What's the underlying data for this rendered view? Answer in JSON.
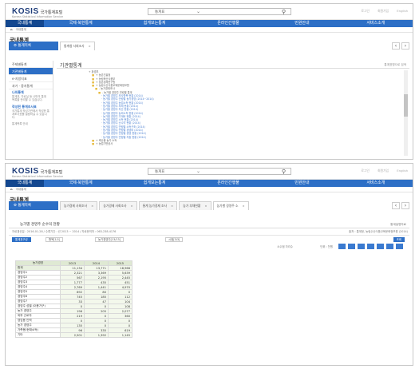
{
  "header": {
    "logo": "KOSIS",
    "logo_kr": "국가통계포털",
    "logo_sub": "Korean Statistical Information Service",
    "search_select": "통계표",
    "utils": [
      "로그인",
      "회원가입",
      "English"
    ]
  },
  "nav": [
    "국내통계",
    "국제·북한통계",
    "쉽게보는통계",
    "온라인간행물",
    "민원안내",
    "서비스소개"
  ],
  "breadcrumb": [
    "홈",
    "국내통계"
  ],
  "page_title": "국내통계",
  "tab_main_label": "통계목록",
  "shot1": {
    "tabs": [
      "통계청 사회조사"
    ],
    "sidebar_items": [
      "주제별통계",
      "기관별통계",
      "e-지방지표",
      "과거 · 중지통계"
    ],
    "side_blocks": [
      {
        "title": "나의통계",
        "text": "통계표, 자료실 등 나만의 통계 목록을 관리할 수 있습니다."
      },
      {
        "title": "작성된 통계조사표",
        "text": "국가통계 작성기관에서 작성한 통계조사표를 열람하실 수 있습니다."
      }
    ],
    "side_footer": "통계목록 안내",
    "panel_title": "기관별통계",
    "panel_right": "통계표명으로 검색",
    "tree": [
      {
        "indent": 18,
        "text": "+ 환경부"
      },
      {
        "indent": 22,
        "text": "+ 농촌진흥청",
        "folder": true
      },
      {
        "indent": 22,
        "text": "+ 농림축산식품부",
        "folder": true
      },
      {
        "indent": 22,
        "text": "+ 농촌경제연구원",
        "folder": true
      },
      {
        "indent": 22,
        "text": "+ 농림수산식품교육문화정보원",
        "folder": true
      },
      {
        "indent": 26,
        "text": "- 농가경제조사",
        "folder": true
      },
      {
        "indent": 30,
        "text": "- 농가별 경영주 연령별 통계",
        "folder": true
      },
      {
        "indent": 34,
        "text": "· 농가별 경영주 조사항목 현황 (2014)",
        "link": true
      },
      {
        "indent": 34,
        "text": "· 농가별 경영주 연령별 농가경영 (2014~2014)",
        "link": true
      },
      {
        "indent": 34,
        "text": "· 농가별 경영주 농업소득 현황 (2014)",
        "link": true
      },
      {
        "indent": 34,
        "text": "· 농가별 경영주 부채 현황 (2014)",
        "link": true
      },
      {
        "indent": 34,
        "text": "· 농가별 경영주 자산 현황 (2014)",
        "link": true
      },
      {
        "indent": 34,
        "text": "· 농가별 경영주 농외소득 현황 (2014)",
        "link": true
      },
      {
        "indent": 34,
        "text": "· 농가별 경영주 가계비 현황 (2014)",
        "link": true
      },
      {
        "indent": 34,
        "text": "· 농가별 경영주 소득 현황 (2014)",
        "link": true
      },
      {
        "indent": 34,
        "text": "· 농가별 경영주 순수익 현황 (2014)",
        "link": true
      },
      {
        "indent": 34,
        "text": "· 농가별 경영주 연령별 소득구조 (2014)",
        "link": true
      },
      {
        "indent": 34,
        "text": "· 농가별 경영주 연령별 경영비 (2014)",
        "link": true
      },
      {
        "indent": 34,
        "text": "· 농가별 경영주 연령별 경영 현황 (2014)",
        "link": true
      },
      {
        "indent": 34,
        "text": "· 농가별 경영주 연령별 지출 현황 (2014)",
        "link": true
      },
      {
        "indent": 22,
        "text": "+ 축산물 농가 소득",
        "folder": true
      },
      {
        "indent": 22,
        "text": "+ 농업기반공사",
        "folder": true
      }
    ]
  },
  "shot2": {
    "tabs": [
      "농가경제 사회조사",
      "농가경제 사회조사",
      "통계 농가경제 조사",
      "농가 부채현황",
      "농가별 경영주 연",
      "농가별 경영주 소"
    ],
    "table_title": "농가별 경영주 순수익 현황",
    "table_title_right": "통계설명자료",
    "info_left": "자료갱신일 : 2016-01-28 / 수록기간 : 년 2013 ~ 2014 / 자료문의처 : 063-238-4176",
    "info_right": "출처 : 통계청, 농림수산식품교육문화정보원 (2014)",
    "controls": [
      "통계표구성",
      "항목[1/1]",
      "농가경영주[13/13]",
      "시점[3/3]",
      "조회"
    ],
    "toolbar_labels": [
      "소수점 자리수",
      "단위 : 천원"
    ],
    "columns": [
      "농가경영",
      "2013",
      "2014",
      "2015"
    ],
    "rows": [
      [
        "합계",
        "11,134",
        "13,771",
        "18,966"
      ],
      [
        "경영주1",
        "2,321",
        "3,369",
        "5,639"
      ],
      [
        "경영주2",
        "567",
        "2,195",
        "2,445"
      ],
      [
        "경영주3",
        "1,777",
        "435",
        "451"
      ],
      [
        "경영주4",
        "2,769",
        "1,441",
        "4,970"
      ],
      [
        "경영주5",
        "892",
        "80",
        "0"
      ],
      [
        "경영주6",
        "745",
        "185",
        "112"
      ],
      [
        "경영주7",
        "33",
        "47",
        "104"
      ],
      [
        "경영주 성별 (이용가구)",
        "0",
        "0",
        "108"
      ],
      [
        "농가 경영주",
        "196",
        "205",
        "2,077"
      ],
      [
        "외부 근로자",
        "219",
        "0",
        "360"
      ],
      [
        "영업용 인력",
        "0",
        "0",
        "0"
      ],
      [
        "농가 경영주",
        "135",
        "0",
        "0"
      ],
      [
        "가족용(현재소득)",
        "96",
        "335",
        "619"
      ],
      [
        "기타",
        "2,501",
        "1,392",
        "1,145"
      ]
    ]
  }
}
